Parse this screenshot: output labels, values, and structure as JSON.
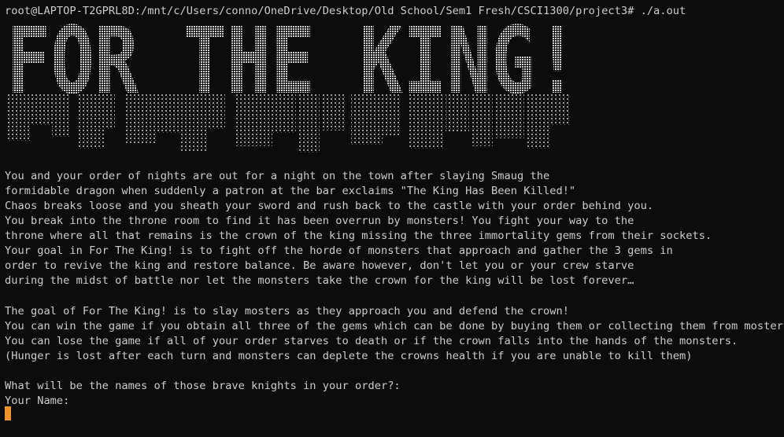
{
  "terminal": {
    "prompt_line": "root@LAPTOP-T2GPRL8D:/mnt/c/Users/conno/OneDrive/Desktop/Old School/Sem1 Fresh/CSCI1300/project3# ./a.out",
    "banner_text": "FOR THE KING!",
    "story": [
      "You and your order of nights are out for a night on the town after slaying Smaug the",
      "formidable dragon when suddenly a patron at the bar exclaims \"The King Has Been Killed!\"",
      "Chaos breaks loose and you sheath your sword and rush back to the castle with your order behind you.",
      "You break into the throne room to find it has been overrun by monsters! You fight your way to the",
      "throne where all that remains is the crown of the king missing the three immortality gems from their sockets.",
      "Your goal in For The King! is to fight off the horde of monsters that approach and gather the 3 gems in",
      "order to revive the king and restore balance. Be aware however, don't let you or your crew starve",
      "during the midst of battle nor let the monsters take the crown for the king will be lost forever…"
    ],
    "rules": [
      "The goal of For The King! is to slay mosters as they approach you and defend the crown!",
      "You can win the game if you obtain all three of the gems which can be done by buying them or collecting them from mosters.",
      "You can lose the game if all of your order starves to death or if the crown falls into the hands of the monsters.",
      "(Hunger is lost after each turn and monsters can deplete the crowns health if you are unable to kill them)"
    ],
    "question": "What will be the names of those brave knights in your order?:",
    "name_prompt": "Your Name:"
  },
  "colors": {
    "background": "#0c0c0c",
    "text": "#cccccc",
    "banner": "#c8c8c8",
    "cursor": "#f0922b"
  }
}
